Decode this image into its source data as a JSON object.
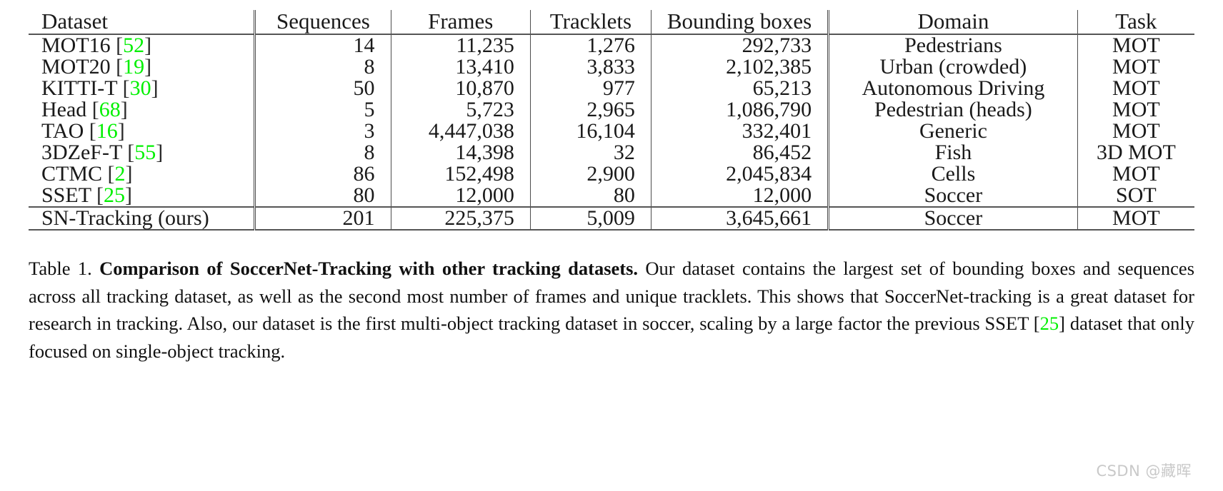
{
  "table": {
    "columns": [
      {
        "key": "dataset",
        "label": "Dataset"
      },
      {
        "key": "sequences",
        "label": "Sequences"
      },
      {
        "key": "frames",
        "label": "Frames"
      },
      {
        "key": "tracklets",
        "label": "Tracklets"
      },
      {
        "key": "bounding_boxes",
        "label": "Bounding boxes"
      },
      {
        "key": "domain",
        "label": "Domain"
      },
      {
        "key": "task",
        "label": "Task"
      }
    ],
    "rows": [
      {
        "name": "MOT16",
        "cite": "52",
        "sequences": "14",
        "frames": "11,235",
        "tracklets": "1,276",
        "bounding_boxes": "292,733",
        "domain": "Pedestrians",
        "task": "MOT"
      },
      {
        "name": "MOT20",
        "cite": "19",
        "sequences": "8",
        "frames": "13,410",
        "tracklets": "3,833",
        "bounding_boxes": "2,102,385",
        "domain": "Urban (crowded)",
        "task": "MOT"
      },
      {
        "name": "KITTI-T",
        "cite": "30",
        "sequences": "50",
        "frames": "10,870",
        "tracklets": "977",
        "bounding_boxes": "65,213",
        "domain": "Autonomous Driving",
        "task": "MOT"
      },
      {
        "name": "Head",
        "cite": "68",
        "sequences": "5",
        "frames": "5,723",
        "tracklets": "2,965",
        "bounding_boxes": "1,086,790",
        "domain": "Pedestrian (heads)",
        "task": "MOT"
      },
      {
        "name": "TAO",
        "cite": "16",
        "sequences": "3",
        "frames": "4,447,038",
        "tracklets": "16,104",
        "bounding_boxes": "332,401",
        "domain": "Generic",
        "task": "MOT"
      },
      {
        "name": "3DZeF-T",
        "cite": "55",
        "sequences": "8",
        "frames": "14,398",
        "tracklets": "32",
        "bounding_boxes": "86,452",
        "domain": "Fish",
        "task": "3D MOT"
      },
      {
        "name": "CTMC",
        "cite": "2",
        "sequences": "86",
        "frames": "152,498",
        "tracklets": "2,900",
        "bounding_boxes": "2,045,834",
        "domain": "Cells",
        "task": "MOT"
      },
      {
        "name": "SSET",
        "cite": "25",
        "sequences": "80",
        "frames": "12,000",
        "tracklets": "80",
        "bounding_boxes": "12,000",
        "domain": "Soccer",
        "task": "SOT"
      }
    ],
    "total_row": {
      "name": "SN-Tracking (ours)",
      "sequences": "201",
      "frames": "225,375",
      "tracklets": "5,009",
      "bounding_boxes": "3,645,661",
      "domain": "Soccer",
      "task": "MOT"
    }
  },
  "caption": {
    "label": "Table 1.",
    "bold_title": "Comparison of SoccerNet-Tracking with other tracking datasets.",
    "text_part1": "Our dataset contains the largest set of bounding boxes and sequences across all tracking dataset, as well as the second most number of frames and unique tracklets. This shows that SoccerNet-tracking is a great dataset for research in tracking. Also, our dataset is the first multi-object tracking dataset in soccer, scaling by a large factor the previous SSET [",
    "inline_cite": "25",
    "text_part2": "] dataset that only focused on single-object tracking."
  },
  "watermark": {
    "text": "CSDN @藏晖"
  },
  "colors": {
    "citation_green": "#00f000",
    "rule_gray": "#555555",
    "text": "#1a1a1a",
    "watermark_gray": "#c9c9c9"
  }
}
